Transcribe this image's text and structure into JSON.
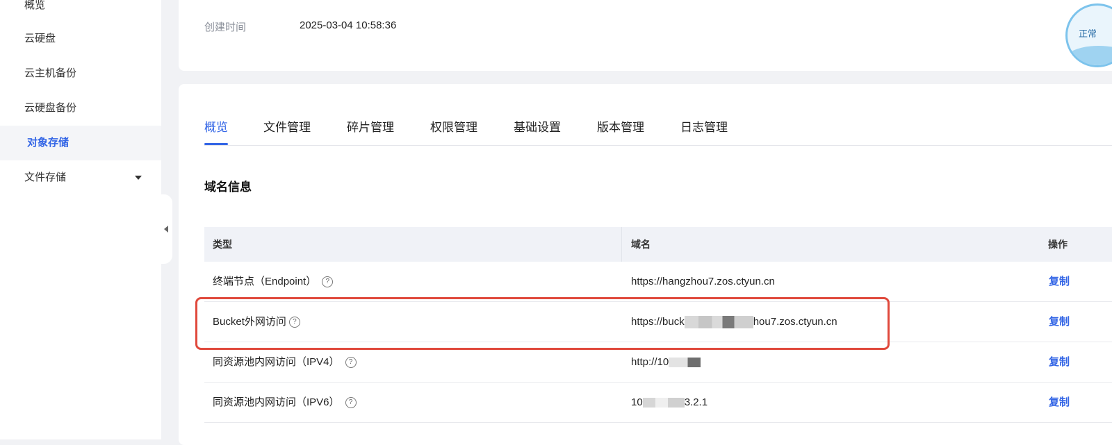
{
  "sidebar": {
    "items": [
      {
        "label": "概览"
      },
      {
        "label": "云硬盘"
      },
      {
        "label": "云主机备份"
      },
      {
        "label": "云硬盘备份"
      },
      {
        "label": "对象存储"
      },
      {
        "label": "文件存储"
      }
    ]
  },
  "info": {
    "created_label": "创建时间",
    "created_value": "2025-03-04 10:58:36",
    "status_text": "正常"
  },
  "tabs": [
    "概览",
    "文件管理",
    "碎片管理",
    "权限管理",
    "基础设置",
    "版本管理",
    "日志管理"
  ],
  "section_title": "域名信息",
  "table": {
    "headers": {
      "type": "类型",
      "domain": "域名",
      "action": "操作"
    },
    "rows": [
      {
        "type": "终端节点（Endpoint）",
        "domain": "https://hangzhou7.zos.ctyun.cn",
        "action": "复制"
      },
      {
        "type": "Bucket外网访问",
        "domain_prefix": "https://buck",
        "domain_suffix": "hou7.zos.ctyun.cn",
        "action": "复制"
      },
      {
        "type": "同资源池内网访问（IPV4）",
        "domain_prefix": "http://10",
        "domain_suffix": "",
        "action": "复制"
      },
      {
        "type": "同资源池内网访问（IPV6）",
        "domain_prefix": "10",
        "domain_suffix": "3.2.1",
        "action": "复制"
      }
    ]
  },
  "icons": {
    "help": "question-circle-icon",
    "caret": "caret-down-icon",
    "collapse": "caret-left-icon"
  },
  "colors": {
    "accent": "#3466e6",
    "highlight": "#e0493c"
  }
}
